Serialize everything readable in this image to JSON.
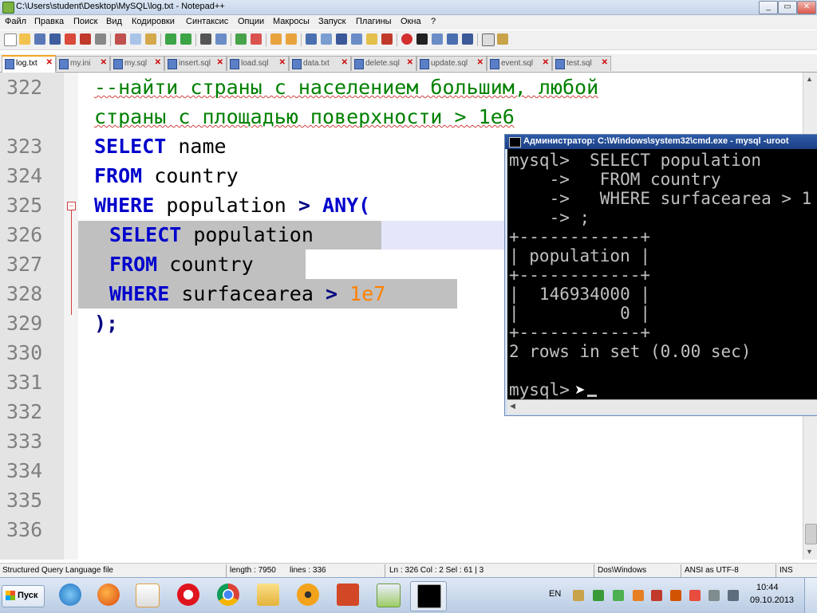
{
  "window": {
    "title": "C:\\Users\\student\\Desktop\\MySQL\\log.txt - Notepad++"
  },
  "menu": [
    "Файл",
    "Правка",
    "Поиск",
    "Вид",
    "Кодировки",
    "Синтаксис",
    "Опции",
    "Макросы",
    "Запуск",
    "Плагины",
    "Окна",
    "?"
  ],
  "tabs": [
    {
      "label": "log.txt",
      "active": true
    },
    {
      "label": "my.ini"
    },
    {
      "label": "my.sql"
    },
    {
      "label": "insert.sql"
    },
    {
      "label": "load.sql"
    },
    {
      "label": "data.txt"
    },
    {
      "label": "delete.sql"
    },
    {
      "label": "update.sql"
    },
    {
      "label": "event.sql"
    },
    {
      "label": "test.sql"
    }
  ],
  "editor": {
    "line_numbers": [
      "322",
      "323",
      "324",
      "325",
      "326",
      "327",
      "328",
      "329",
      "330",
      "331",
      "332",
      "333",
      "334",
      "335",
      "336"
    ],
    "comment_1": "--найти страны с населением большим, любой",
    "comment_2": "страны с площадью поверхности > 1e6",
    "kw_select": "SELECT",
    "kw_from": "FROM",
    "kw_where": "WHERE",
    "kw_any": "ANY(",
    "op_gt": ">",
    "id_name": "name",
    "id_country": "country",
    "id_population": "population",
    "id_surfacearea": "surfacearea",
    "num_1e7": "1e7",
    "close_paren": ");"
  },
  "cmd": {
    "title": "Администратор: C:\\Windows\\system32\\cmd.exe - mysql -uroot",
    "lines": [
      "mysql>  SELECT population",
      "    ->   FROM country",
      "    ->   WHERE surfacearea > 1",
      "    -> ;",
      "+------------+",
      "| population |",
      "+------------+",
      "|  146934000 |",
      "|          0 |",
      "+------------+",
      "2 rows in set (0.00 sec)",
      "",
      "mysql>"
    ]
  },
  "status": {
    "filetype": "Structured Query Language file",
    "length": "length : 7950",
    "lines": "lines : 336",
    "position": "Ln : 326   Col : 2   Sel : 61 | 3",
    "eol": "Dos\\Windows",
    "encoding": "ANSI as UTF-8",
    "mode": "INS"
  },
  "taskbar": {
    "start_label": "Пуск",
    "lang": "EN",
    "time": "10:44",
    "date": "09.10.2013",
    "apps": [
      "ie-icon",
      "firefox-icon",
      "media-player-icon",
      "opera-icon",
      "chrome-icon",
      "file-explorer-icon",
      "flower-app-icon",
      "powerpoint-icon",
      "notepadpp-icon",
      "cmd-icon"
    ]
  },
  "colors": {
    "keyword": "#0000cc",
    "comment": "#008000",
    "number": "#ff8000",
    "selection": "#c0c0c0"
  }
}
